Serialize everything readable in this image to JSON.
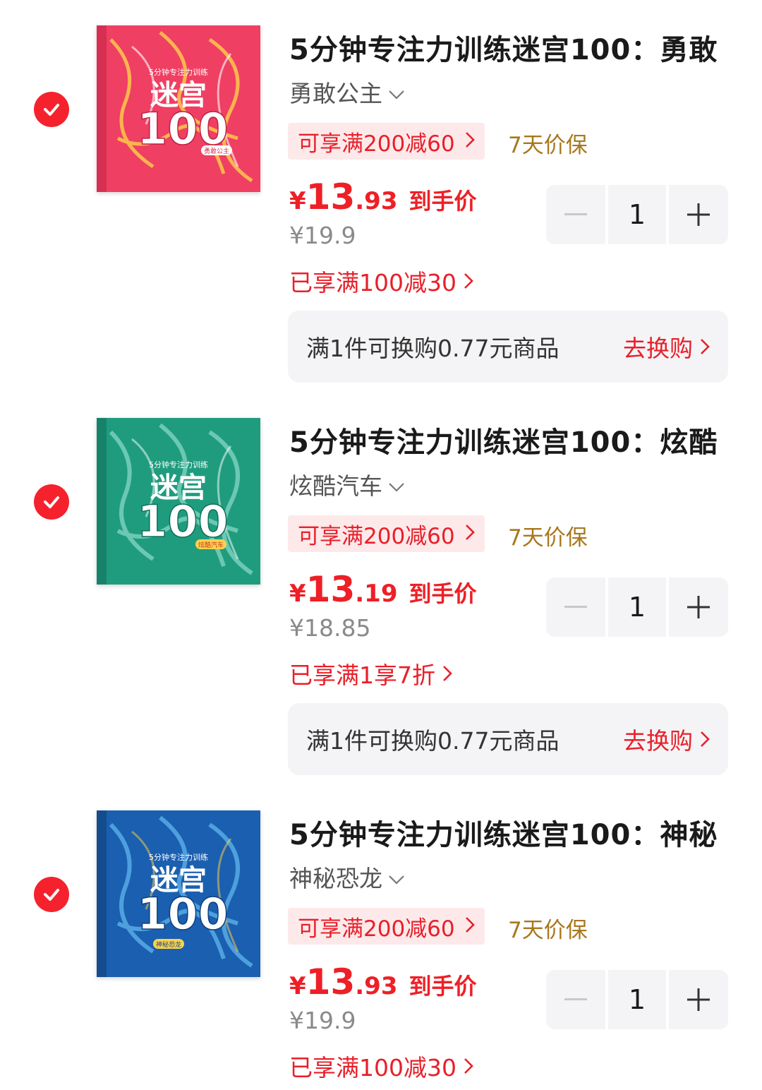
{
  "items": [
    {
      "title": "5分钟专注力训练迷宫100：勇敢",
      "variant": "勇敢公主",
      "promo": "可享满200减60",
      "guarantee": "7天价保",
      "price_currency": "¥",
      "price_int": "13",
      "price_dec": ".93",
      "price_label": "到手价",
      "original_price": "¥19.9",
      "applied_discount": "已享满100减30",
      "quantity": "1",
      "exchange_text": "满1件可换购0.77元商品",
      "exchange_action": "去换购",
      "cover": {
        "top_text": "5分钟专注力训练",
        "main_text": "迷宫",
        "number": "100",
        "badge": "勇敢公主",
        "bg": "#ef3f63",
        "path": "#ffd24a"
      }
    },
    {
      "title": "5分钟专注力训练迷宫100：炫酷",
      "variant": "炫酷汽车",
      "promo": "可享满200减60",
      "guarantee": "7天价保",
      "price_currency": "¥",
      "price_int": "13",
      "price_dec": ".19",
      "price_label": "到手价",
      "original_price": "¥18.85",
      "applied_discount": "已享满1享7折",
      "quantity": "1",
      "exchange_text": "满1件可换购0.77元商品",
      "exchange_action": "去换购",
      "cover": {
        "top_text": "5分钟专注力训练",
        "main_text": "迷宫",
        "number": "100",
        "badge": "炫酷汽车",
        "bg": "#1f9c7e",
        "path": "#7fd3c0"
      }
    },
    {
      "title": "5分钟专注力训练迷宫100：神秘",
      "variant": "神秘恐龙",
      "promo": "可享满200减60",
      "guarantee": "7天价保",
      "price_currency": "¥",
      "price_int": "13",
      "price_dec": ".93",
      "price_label": "到手价",
      "original_price": "¥19.9",
      "applied_discount": "已享满100减30",
      "quantity": "1",
      "cover": {
        "top_text": "5分钟专注力训练",
        "main_text": "迷宫",
        "number": "100",
        "badge": "神秘恐龙",
        "bg": "#1b5fb0",
        "path": "#5ab0e8"
      }
    }
  ]
}
